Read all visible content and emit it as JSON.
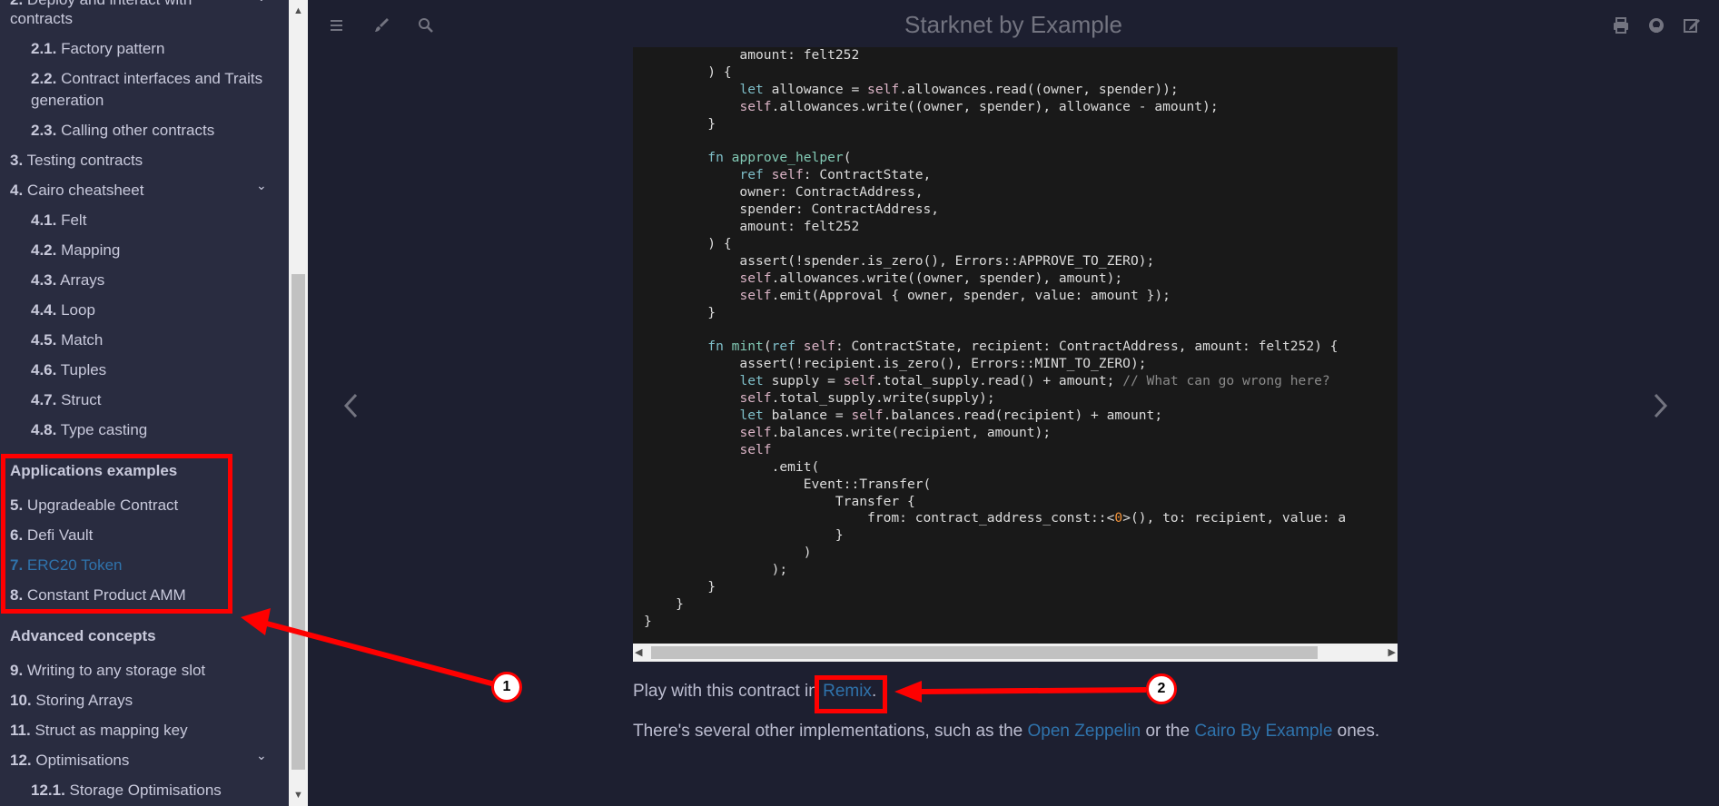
{
  "sidebar": {
    "items": [
      {
        "num": "2.",
        "label": "Deploy and interact with"
      },
      {
        "num": "",
        "label": "contracts"
      },
      {
        "num": "2.1.",
        "label": "Factory pattern"
      },
      {
        "num": "2.2.",
        "label": "Contract interfaces and Traits"
      },
      {
        "num": "",
        "label": "generation"
      },
      {
        "num": "2.3.",
        "label": "Calling other contracts"
      },
      {
        "num": "3.",
        "label": "Testing contracts"
      },
      {
        "num": "4.",
        "label": "Cairo cheatsheet"
      },
      {
        "num": "4.1.",
        "label": "Felt"
      },
      {
        "num": "4.2.",
        "label": "Mapping"
      },
      {
        "num": "4.3.",
        "label": "Arrays"
      },
      {
        "num": "4.4.",
        "label": "Loop"
      },
      {
        "num": "4.5.",
        "label": "Match"
      },
      {
        "num": "4.6.",
        "label": "Tuples"
      },
      {
        "num": "4.7.",
        "label": "Struct"
      },
      {
        "num": "4.8.",
        "label": "Type casting"
      },
      {
        "num": "5.",
        "label": "Upgradeable Contract"
      },
      {
        "num": "6.",
        "label": "Defi Vault"
      },
      {
        "num": "7.",
        "label": "ERC20 Token"
      },
      {
        "num": "8.",
        "label": "Constant Product AMM"
      },
      {
        "num": "9.",
        "label": "Writing to any storage slot"
      },
      {
        "num": "10.",
        "label": "Storing Arrays"
      },
      {
        "num": "11.",
        "label": "Struct as mapping key"
      },
      {
        "num": "12.",
        "label": "Optimisations"
      },
      {
        "num": "12.1.",
        "label": "Storage Optimisations"
      }
    ],
    "headings": {
      "applications": "Applications examples",
      "advanced": "Advanced concepts"
    },
    "chevron": "⌄"
  },
  "toolbar": {
    "title": "Starknet by Example",
    "icons": [
      "menu-icon",
      "paintbrush-icon",
      "search-icon",
      "print-icon",
      "github-icon",
      "edit-icon"
    ]
  },
  "code": {
    "lines": [
      "            amount: felt252",
      "        ) {",
      "            let allowance = self.allowances.read((owner, spender));",
      "            self.allowances.write((owner, spender), allowance - amount);",
      "        }",
      "",
      "        fn approve_helper(",
      "            ref self: ContractState,",
      "            owner: ContractAddress,",
      "            spender: ContractAddress,",
      "            amount: felt252",
      "        ) {",
      "            assert(!spender.is_zero(), Errors::APPROVE_TO_ZERO);",
      "            self.allowances.write((owner, spender), amount);",
      "            self.emit(Approval { owner, spender, value: amount });",
      "        }",
      "",
      "        fn mint(ref self: ContractState, recipient: ContractAddress, amount: felt252) {",
      "            assert(!recipient.is_zero(), Errors::MINT_TO_ZERO);",
      "            let supply = self.total_supply.read() + amount; // What can go wrong here?",
      "            self.total_supply.write(supply);",
      "            let balance = self.balances.read(recipient) + amount;",
      "            self.balances.write(recipient, amount);",
      "            self",
      "                .emit(",
      "                    Event::Transfer(",
      "                        Transfer {",
      "                            from: contract_address_const::<0>(), to: recipient, value: a",
      "                        }",
      "                    )",
      "                );",
      "        }",
      "    }",
      "}"
    ]
  },
  "content": {
    "remix_prefix": "Play with this contract in ",
    "remix_link": "Remix",
    "remix_suffix": ".",
    "impl_prefix": "There's several other implementations, such as the ",
    "oz_link": "Open Zeppelin",
    "impl_mid": " or the ",
    "cbe_link": "Cairo By Example",
    "impl_suffix": " ones."
  },
  "annotations": {
    "badge1": "1",
    "badge2": "2"
  },
  "colors": {
    "accent": "#2f73ac",
    "annotation": "#ff0000",
    "sidebar_bg": "#292c40",
    "main_bg": "#1d1f30",
    "code_bg": "#191919"
  }
}
